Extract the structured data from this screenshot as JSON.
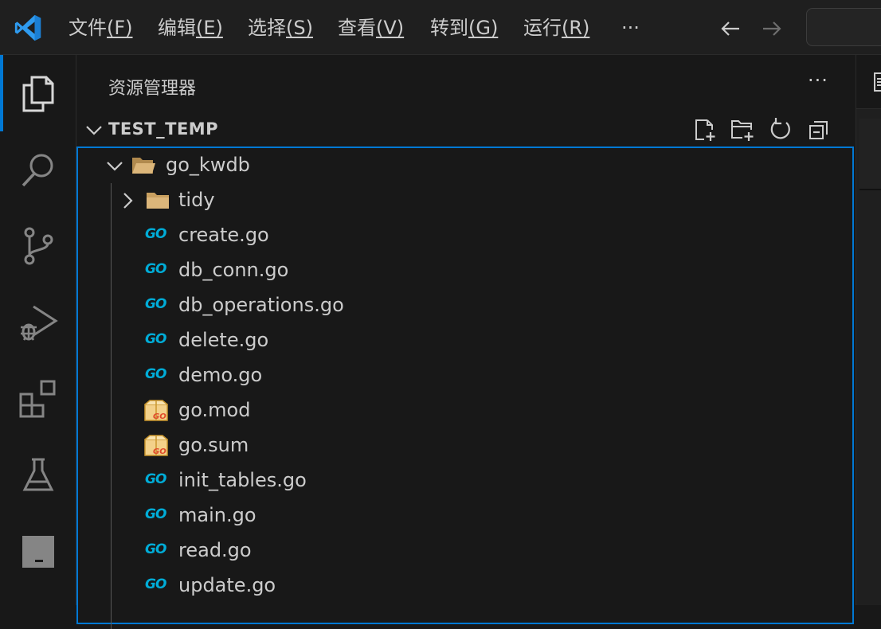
{
  "menu": {
    "items": [
      {
        "base": "文件",
        "mnemonic": "(F)"
      },
      {
        "base": "编辑",
        "mnemonic": "(E)"
      },
      {
        "base": "选择",
        "mnemonic": "(S)"
      },
      {
        "base": "查看",
        "mnemonic": "(V)"
      },
      {
        "base": "转到",
        "mnemonic": "(G)"
      },
      {
        "base": "运行",
        "mnemonic": "(R)"
      }
    ],
    "more": "···"
  },
  "explorer": {
    "title": "资源管理器",
    "more": "···",
    "section_title": "TEST_TEMP"
  },
  "tree": {
    "folder": "go_kwdb",
    "subfolder": "tidy",
    "files": [
      {
        "name": "create.go",
        "type": "go"
      },
      {
        "name": "db_conn.go",
        "type": "go"
      },
      {
        "name": "db_operations.go",
        "type": "go"
      },
      {
        "name": "delete.go",
        "type": "go"
      },
      {
        "name": "demo.go",
        "type": "go"
      },
      {
        "name": "go.mod",
        "type": "gomod"
      },
      {
        "name": "go.sum",
        "type": "gomod"
      },
      {
        "name": "init_tables.go",
        "type": "go"
      },
      {
        "name": "main.go",
        "type": "go"
      },
      {
        "name": "read.go",
        "type": "go"
      },
      {
        "name": "update.go",
        "type": "go"
      }
    ]
  },
  "icons": {
    "app_logo": "vscode-logo-icon",
    "go_file": "go-file-icon",
    "go_mod_file": "go-mod-file-icon"
  },
  "colors": {
    "accent": "#0078d4",
    "go_icon": "#00acd7",
    "folder": "#dcb67a"
  }
}
